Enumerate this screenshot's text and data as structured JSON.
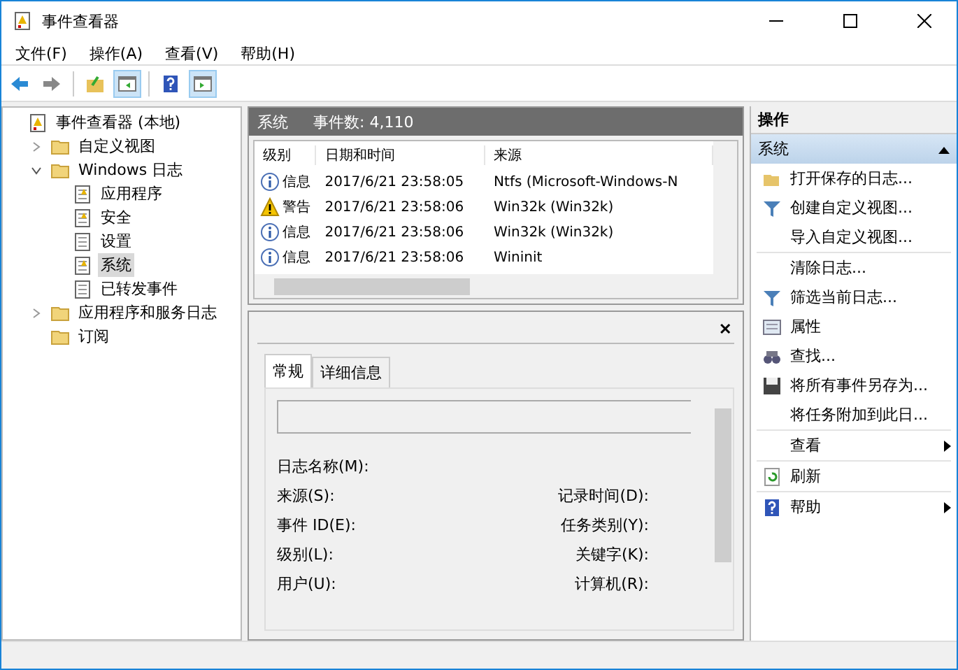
{
  "window": {
    "title": "事件查看器"
  },
  "menu": [
    "文件(F)",
    "操作(A)",
    "查看(V)",
    "帮助(H)"
  ],
  "toolbar": [
    {
      "kind": "back",
      "on": false
    },
    {
      "kind": "forward",
      "on": false
    },
    {
      "kind": "up",
      "on": false
    },
    {
      "kind": "tree",
      "on": true
    },
    {
      "kind": "help",
      "on": false
    },
    {
      "kind": "pane",
      "on": true
    }
  ],
  "tree": {
    "label": "事件查看器 (本地)",
    "selected": false,
    "children": [
      {
        "label": "自定义视图",
        "selected": false,
        "expanded": false,
        "kind": "folder"
      },
      {
        "label": "Windows 日志",
        "selected": false,
        "expanded": true,
        "kind": "folder",
        "children": [
          {
            "label": "应用程序",
            "selected": false,
            "kind": "log"
          },
          {
            "label": "安全",
            "selected": false,
            "kind": "log"
          },
          {
            "label": "设置",
            "selected": false,
            "kind": "plain"
          },
          {
            "label": "系统",
            "selected": true,
            "kind": "log"
          },
          {
            "label": "已转发事件",
            "selected": false,
            "kind": "plain"
          }
        ]
      },
      {
        "label": "应用程序和服务日志",
        "selected": false,
        "expanded": false,
        "kind": "folder"
      },
      {
        "label": "订阅",
        "selected": false,
        "kind": "folder"
      }
    ]
  },
  "events": {
    "title": "系统",
    "count": "事件数: 4,110",
    "columns": [
      "级别",
      "日期和时间",
      "来源"
    ],
    "rows": [
      {
        "kind": "info",
        "level": "信息",
        "datetime": "2017/6/21 23:58:05",
        "source": "Ntfs (Microsoft-Windows-N"
      },
      {
        "kind": "warning",
        "level": "警告",
        "datetime": "2017/6/21 23:58:06",
        "source": "Win32k (Win32k)"
      },
      {
        "kind": "info",
        "level": "信息",
        "datetime": "2017/6/21 23:58:06",
        "source": "Win32k (Win32k)"
      },
      {
        "kind": "info",
        "level": "信息",
        "datetime": "2017/6/21 23:58:06",
        "source": "Wininit"
      }
    ]
  },
  "details": {
    "close": "✕",
    "tabs": [
      {
        "label": "常规",
        "selected": true
      },
      {
        "label": "详细信息",
        "selected": false
      }
    ],
    "fields": [
      {
        "left": "日志名称(M):"
      },
      {
        "left": "来源(S):",
        "right": "记录时间(D):"
      },
      {
        "left": "事件 ID(E):",
        "right": "任务类别(Y):"
      },
      {
        "left": "级别(L):",
        "right": "关键字(K):"
      },
      {
        "left": "用户(U):",
        "right": "计算机(R):"
      }
    ]
  },
  "actions": {
    "title": "操作",
    "section": {
      "label": "系统",
      "expanded": true
    },
    "items": [
      {
        "label": "打开保存的日志...",
        "kind": "open",
        "divider_before": false,
        "submenu": false
      },
      {
        "label": "创建自定义视图...",
        "kind": "filter",
        "divider_before": false,
        "submenu": false
      },
      {
        "label": "导入自定义视图...",
        "kind": "none",
        "divider_before": false,
        "submenu": false
      },
      {
        "label": "清除日志...",
        "kind": "none",
        "divider_before": true,
        "submenu": false
      },
      {
        "label": "筛选当前日志...",
        "kind": "filter",
        "divider_before": false,
        "submenu": false
      },
      {
        "label": "属性",
        "kind": "props",
        "divider_before": false,
        "submenu": false
      },
      {
        "label": "查找...",
        "kind": "find",
        "divider_before": false,
        "submenu": false
      },
      {
        "label": "将所有事件另存为...",
        "kind": "save",
        "divider_before": false,
        "submenu": false
      },
      {
        "label": "将任务附加到此日...",
        "kind": "none",
        "divider_before": false,
        "submenu": false
      },
      {
        "label": "查看",
        "kind": "none",
        "divider_before": true,
        "submenu": true
      },
      {
        "label": "刷新",
        "kind": "refresh",
        "divider_before": true,
        "submenu": false
      },
      {
        "label": "帮助",
        "kind": "help",
        "divider_before": true,
        "submenu": true
      }
    ]
  }
}
